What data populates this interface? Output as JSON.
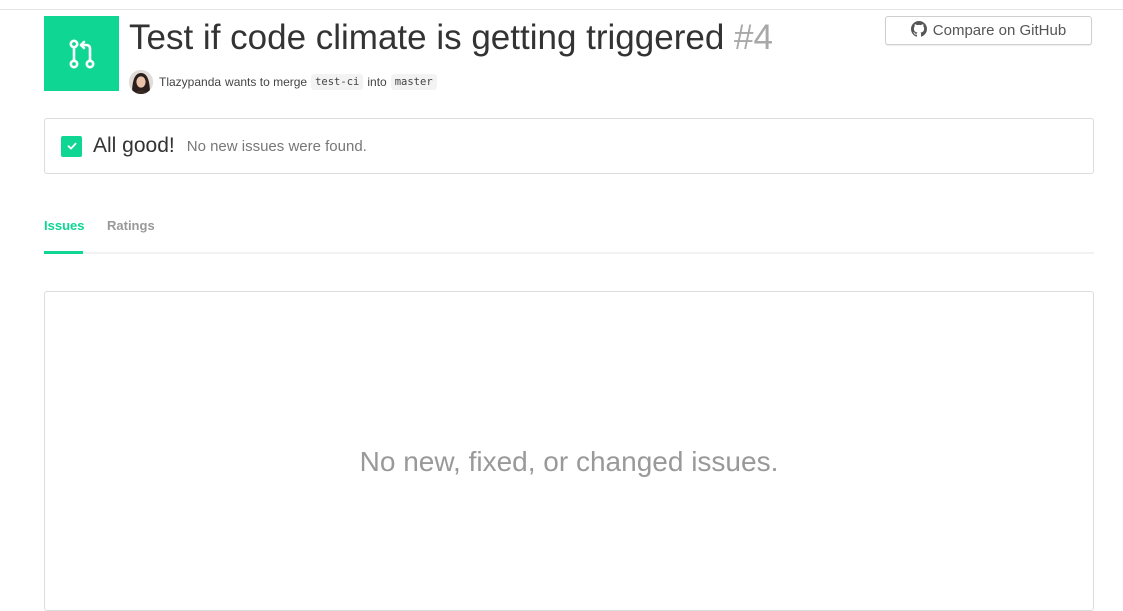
{
  "header": {
    "title": "Test if code climate is getting triggered",
    "number": "#4",
    "author": "Tlazypanda",
    "merge_text_1": "wants to merge",
    "source_branch": "test-ci",
    "merge_text_2": "into",
    "target_branch": "master",
    "compare_button_label": "Compare on GitHub"
  },
  "status": {
    "title": "All good!",
    "message": "No new issues were found."
  },
  "tabs": [
    {
      "label": "Issues",
      "active": true
    },
    {
      "label": "Ratings",
      "active": false
    }
  ],
  "issues_panel": {
    "empty_message": "No new, fixed, or changed issues."
  },
  "colors": {
    "accent": "#0fd692",
    "muted_text": "#999999"
  },
  "icons": [
    "pull-request-icon",
    "github-icon",
    "checkmark-icon",
    "avatar"
  ]
}
